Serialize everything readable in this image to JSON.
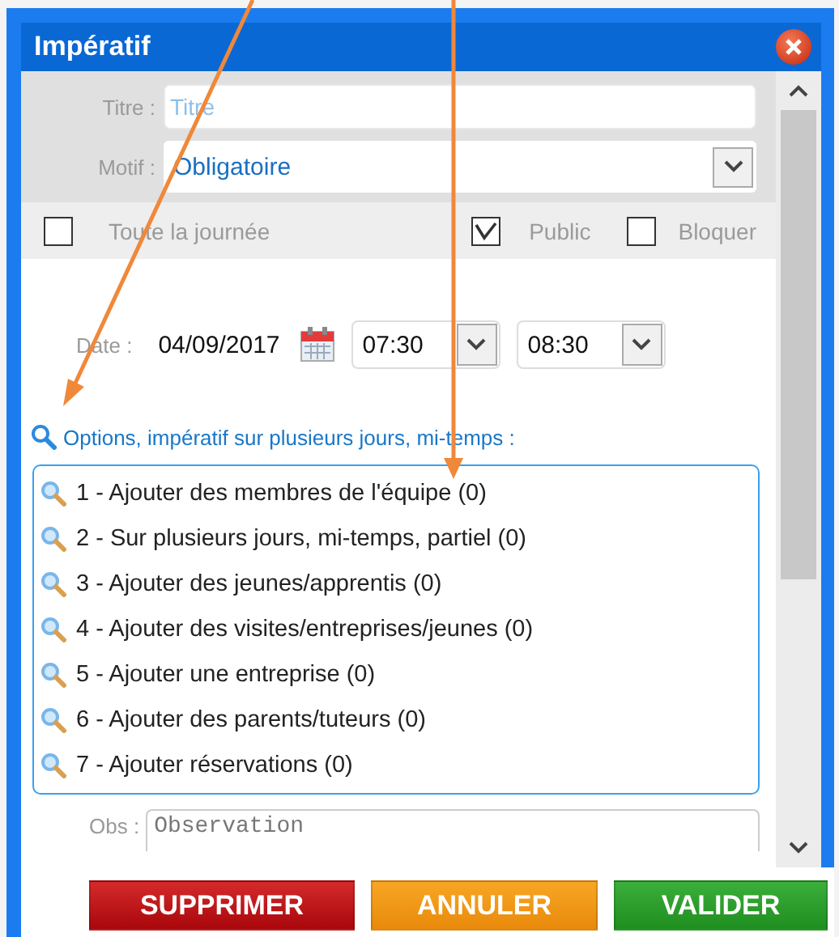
{
  "window": {
    "title": "Impératif"
  },
  "titre": {
    "label": "Titre :",
    "placeholder": "Titre"
  },
  "motif": {
    "label": "Motif :",
    "value": "Obligatoire"
  },
  "checkboxes": [
    {
      "label": "Toute la journée",
      "checked": false
    },
    {
      "label": "Public",
      "checked": true
    },
    {
      "label": "Bloquer",
      "checked": false
    }
  ],
  "date": {
    "label": "Date :",
    "value": "04/09/2017"
  },
  "times": [
    "07:30",
    "08:30"
  ],
  "options": {
    "heading": "Options, impératif sur plusieurs jours, mi-temps :",
    "items": [
      "1 - Ajouter des membres de l'équipe (0)",
      "2 - Sur plusieurs jours, mi-temps, partiel (0)",
      "3 - Ajouter des jeunes/apprentis (0)",
      "4 - Ajouter des visites/entreprises/jeunes (0)",
      "5 - Ajouter une entreprise (0)",
      "6 - Ajouter des parents/tuteurs (0)",
      "7 - Ajouter réservations (0)"
    ]
  },
  "obs": {
    "label": "Obs :",
    "placeholder": "Observation"
  },
  "buttons": [
    {
      "label": "SUPPRIMER",
      "kind": "delete"
    },
    {
      "label": "ANNULER",
      "kind": "cancel"
    },
    {
      "label": "VALIDER",
      "kind": "confirm"
    }
  ]
}
